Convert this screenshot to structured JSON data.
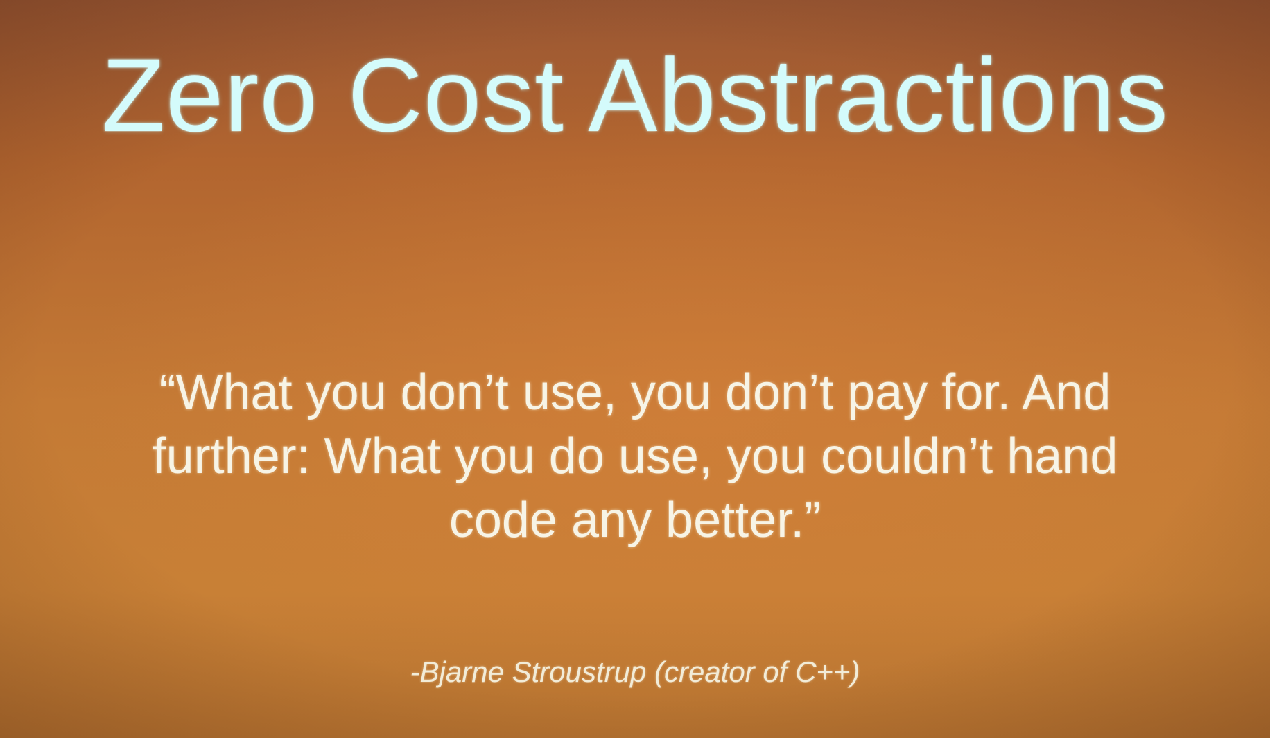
{
  "slide": {
    "title": "Zero Cost Abstractions",
    "quote_lines": [
      "“What you don’t use, you don’t pay for. And",
      "further: What you do use, you couldn’t hand",
      "code any better.”"
    ],
    "attribution": "-Bjarne Stroustrup (creator of C++)"
  },
  "colors": {
    "background": "#c47a35",
    "title_text": "#d4fbfb",
    "body_text": "#f7f4e6"
  }
}
